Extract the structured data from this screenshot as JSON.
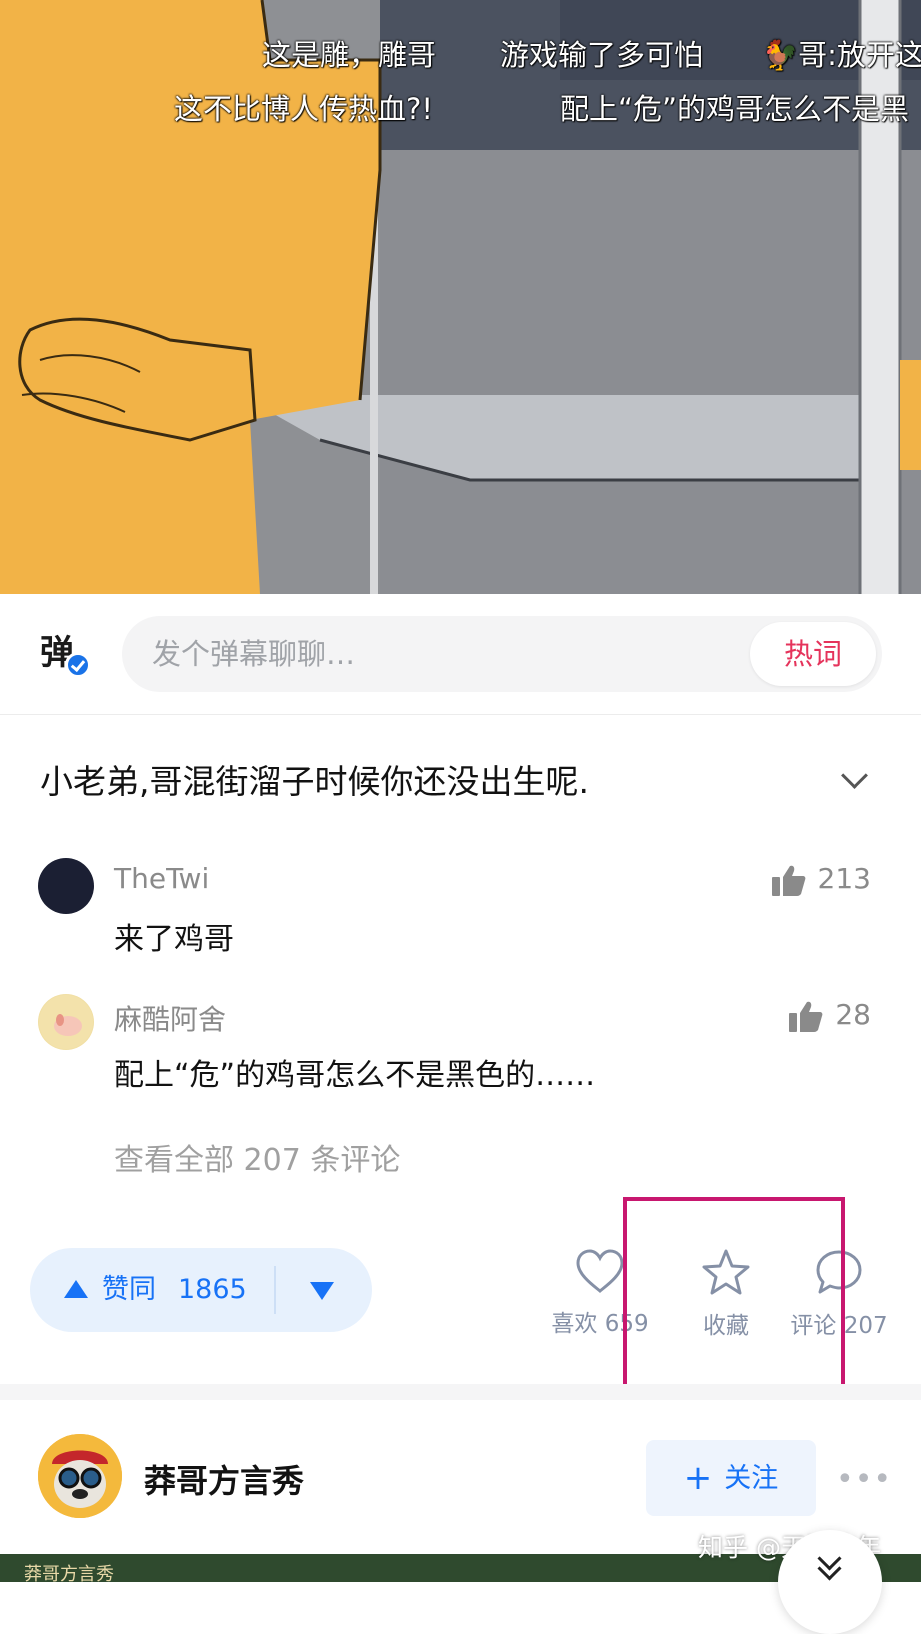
{
  "video": {
    "danmaku": [
      "这是雕，雕哥",
      "游戏输了多可怕",
      "🐓哥:放开这",
      "这不比博人传热血?!",
      "配上“危”的鸡哥怎么不是黑"
    ]
  },
  "danmaku_bar": {
    "toggle_glyph": "弹",
    "placeholder": "发个弹幕聊聊…",
    "hot_words_label": "热词"
  },
  "answer": {
    "title": "小老弟,哥混街溜子时候你还没出生呢."
  },
  "comments": [
    {
      "author": "TheTwi",
      "text": "来了鸡哥",
      "likes": "213"
    },
    {
      "author": "麻酷阿舍",
      "text": "配上“危”的鸡哥怎么不是黑色的……",
      "likes": "28"
    }
  ],
  "view_all_label": "查看全部 207 条评论",
  "actions": {
    "upvote_label": "赞同",
    "upvote_count": "1865",
    "like_label": "喜欢",
    "like_count": "659",
    "collect_label": "收藏",
    "comment_label": "评论",
    "comment_count": "207"
  },
  "next_card": {
    "author_name": "莽哥方言秀",
    "follow_label": "关注",
    "more_label": "•••",
    "thumb_tag": "莽哥方言秀"
  },
  "watermark": "知乎 @天源流年",
  "colors": {
    "accent_blue": "#1772f6",
    "hot_word_red": "#e5335b",
    "highlight_box": "#c8176f"
  }
}
